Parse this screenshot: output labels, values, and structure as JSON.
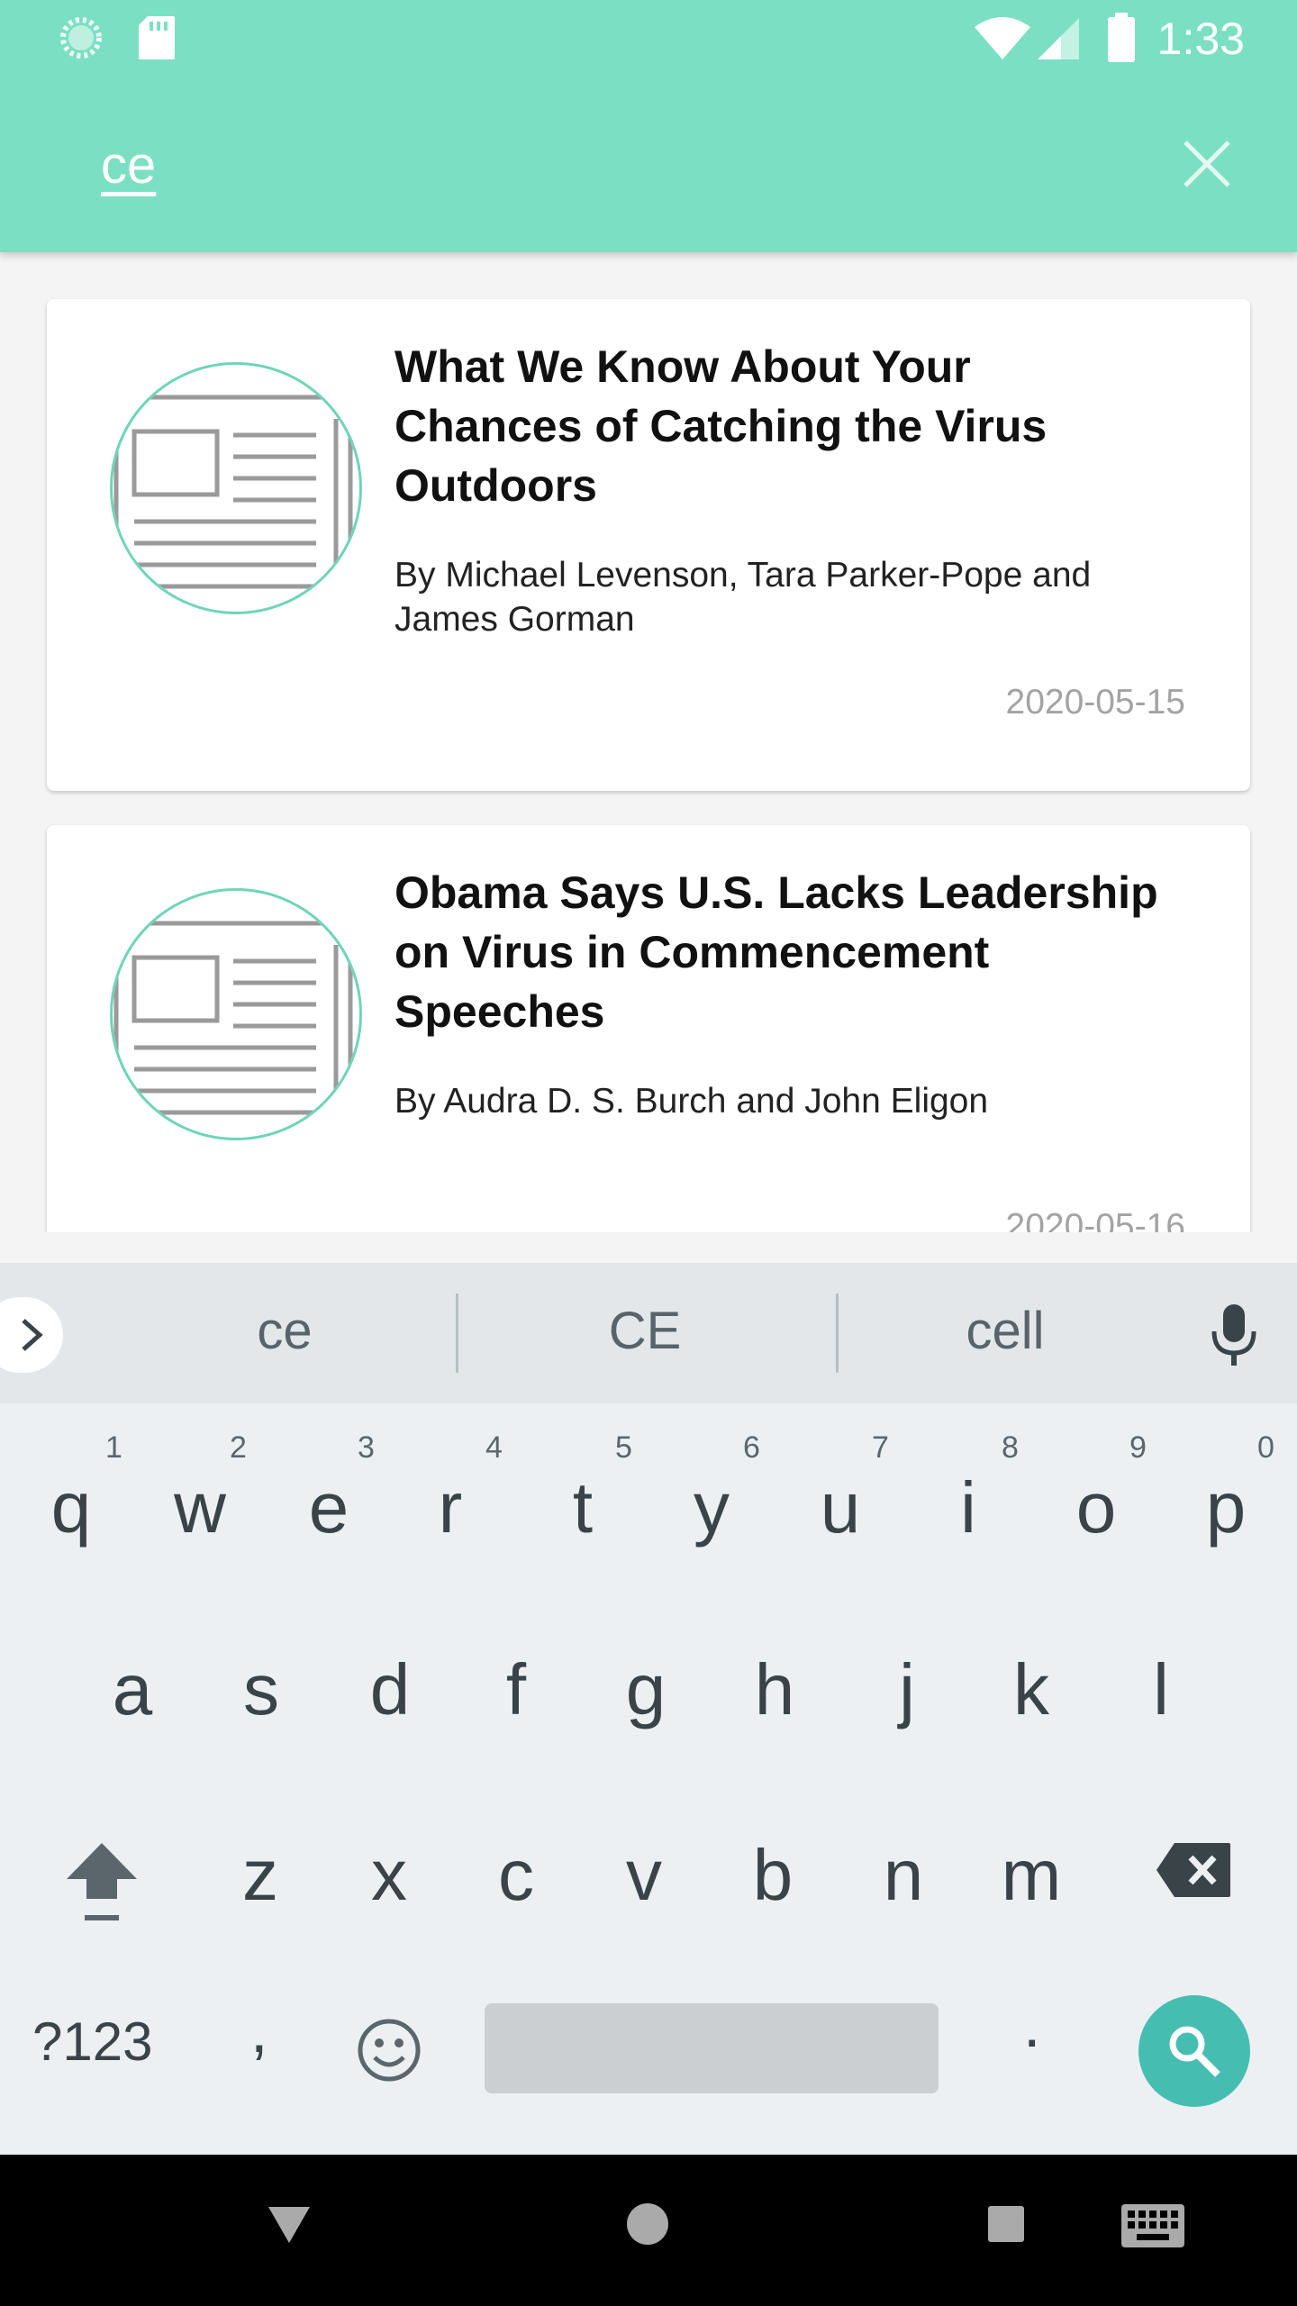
{
  "status_bar": {
    "time": "1:33",
    "icons": [
      "loading-icon",
      "sd-card-icon",
      "wifi-icon",
      "cell-signal-icon",
      "battery-icon"
    ]
  },
  "search": {
    "query": "ce",
    "close_icon": "close-icon"
  },
  "articles": [
    {
      "title": "What We Know About Your Chances of Catching the Virus Outdoors",
      "author": "By Michael Levenson, Tara Parker-Pope and James Gorman",
      "date": "2020-05-15",
      "thumbnail_icon": "newspaper-icon"
    },
    {
      "title": "Obama Says U.S. Lacks Leadership on Virus in Commencement Speeches",
      "author": "By Audra D. S. Burch and John Eligon",
      "date": "2020-05-16",
      "thumbnail_icon": "newspaper-icon"
    }
  ],
  "keyboard": {
    "suggestions": [
      "ce",
      "CE",
      "cell"
    ],
    "row1": [
      "q",
      "w",
      "e",
      "r",
      "t",
      "y",
      "u",
      "i",
      "o",
      "p"
    ],
    "row1_hints": [
      "1",
      "2",
      "3",
      "4",
      "5",
      "6",
      "7",
      "8",
      "9",
      "0"
    ],
    "row2": [
      "a",
      "s",
      "d",
      "f",
      "g",
      "h",
      "j",
      "k",
      "l"
    ],
    "row3": [
      "z",
      "x",
      "c",
      "v",
      "b",
      "n",
      "m"
    ],
    "symbols_label": "?123",
    "comma": ",",
    "period": "."
  },
  "colors": {
    "accent": "#7be0c3",
    "search_key": "#45beb1",
    "thumbnail_ring": "#6ed5b7"
  },
  "nav_bar": {
    "icons": [
      "back-icon",
      "home-icon",
      "recents-icon",
      "keyboard-switch-icon"
    ]
  }
}
